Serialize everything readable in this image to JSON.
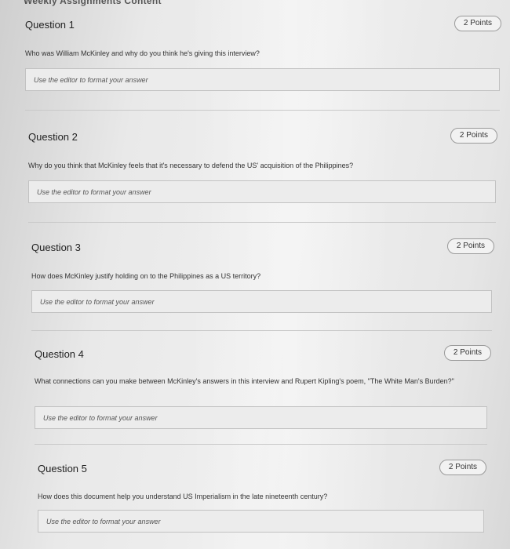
{
  "header": {
    "cut_title": "Weekly Assignments Content"
  },
  "questions": [
    {
      "title": "Question 1",
      "points": "2 Points",
      "prompt": "Who was William McKinley and why do you think he's giving this interview?",
      "placeholder": "Use the editor to format your answer"
    },
    {
      "title": "Question 2",
      "points": "2 Points",
      "prompt": "Why do you think that McKinley feels that it's necessary to defend the US' acquisition of the Philippines?",
      "placeholder": "Use the editor to format your answer"
    },
    {
      "title": "Question 3",
      "points": "2 Points",
      "prompt": "How does McKinley justify holding on to the Philippines as a US territory?",
      "placeholder": "Use the editor to format your answer"
    },
    {
      "title": "Question 4",
      "points": "2 Points",
      "prompt": "What connections can you make between McKinley's answers in this interview and Rupert Kipling's poem, \"The White Man's Burden?\"",
      "placeholder": "Use the editor to format your answer"
    },
    {
      "title": "Question 5",
      "points": "2 Points",
      "prompt": "How does this document help you understand US Imperialism in the late nineteenth century?",
      "placeholder": "Use the editor to format your answer"
    }
  ]
}
